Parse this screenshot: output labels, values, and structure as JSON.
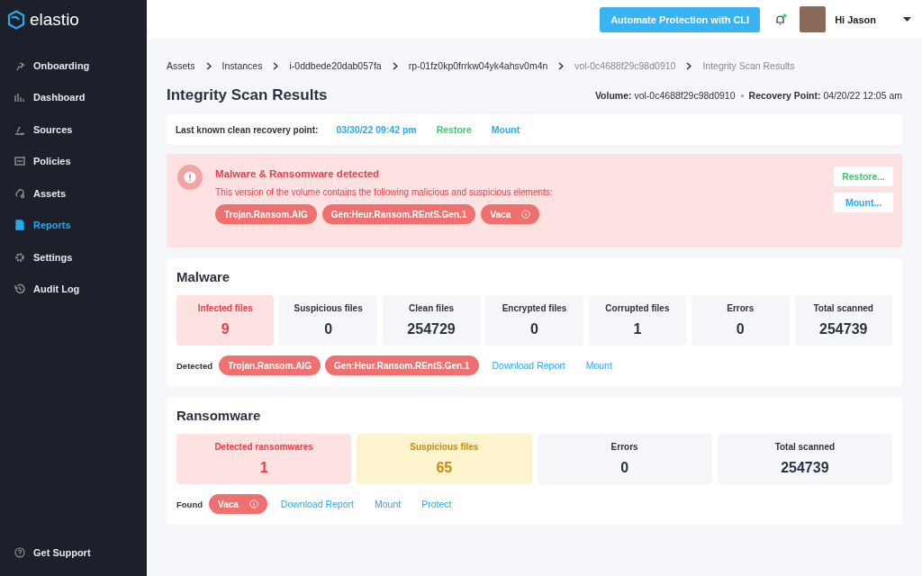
{
  "logo": {
    "text": "elastio"
  },
  "sidebar": {
    "items": [
      {
        "label": "Onboarding",
        "selected": false
      },
      {
        "label": "Dashboard",
        "selected": false
      },
      {
        "label": "Sources",
        "selected": false
      },
      {
        "label": "Policies",
        "selected": false
      },
      {
        "label": "Assets",
        "selected": false
      },
      {
        "label": "Reports",
        "selected": true
      },
      {
        "label": "Settings",
        "selected": false
      },
      {
        "label": "Audit Log",
        "selected": false
      }
    ],
    "support": "Get Support"
  },
  "topbar": {
    "cli_button": "Automate Protection with CLI",
    "notification_dot": true,
    "greeting": "Hi Jason"
  },
  "breadcrumbs": [
    {
      "label": "Assets",
      "current": false
    },
    {
      "label": "Instances",
      "current": false
    },
    {
      "label": "i-0ddbede20dab057fa",
      "current": false
    },
    {
      "label": "rp-01fz0kp0frrkw04yk4ahsv0m4n",
      "current": false
    },
    {
      "label": "vol-0c4688f29c98d0910",
      "current": true
    },
    {
      "label": "Integrity Scan Results",
      "current": true
    }
  ],
  "title": "Integrity Scan Results",
  "meta": [
    {
      "label": "Volume:",
      "value": "vol-0c4688f29c98d0910"
    },
    {
      "label": "Recovery Point:",
      "value": "04/20/22 12:05 am"
    }
  ],
  "clean_point": {
    "label": "Last known clean recovery point:",
    "date": "03/30/22 09:42 pm",
    "links": [
      {
        "label": "Restore",
        "kind": "restore"
      },
      {
        "label": "Mount",
        "kind": "mount"
      }
    ]
  },
  "alert": {
    "title": "Malware & Ransomware detected",
    "message": "This version of the volume contains the following malicious and suspicious elements:",
    "tags": [
      {
        "label": "Trojan.Ransom.AIG",
        "info": false
      },
      {
        "label": "Gen:Heur.Ransom.REntS.Gen.1",
        "info": false
      },
      {
        "label": "Vaca",
        "info": true
      }
    ],
    "buttons": [
      {
        "label": "Restore...",
        "kind": "restore"
      },
      {
        "label": "Mount...",
        "kind": "mount"
      }
    ]
  },
  "sections": [
    {
      "title": "Malware",
      "stats": [
        {
          "label": "Infected files",
          "value": "9",
          "kind": "danger"
        },
        {
          "label": "Suspicious files",
          "value": "0",
          "kind": "neutral"
        },
        {
          "label": "Clean files",
          "value": "254729",
          "kind": "neutral"
        },
        {
          "label": "Encrypted files",
          "value": "0",
          "kind": "neutral"
        },
        {
          "label": "Corrupted files",
          "value": "1",
          "kind": "neutral"
        },
        {
          "label": "Errors",
          "value": "0",
          "kind": "neutral"
        },
        {
          "label": "Total scanned",
          "value": "254739",
          "kind": "neutral"
        }
      ],
      "footer_label": "Detected",
      "tags": [
        {
          "label": "Trojan.Ransom.AIG",
          "info": false
        },
        {
          "label": "Gen:Heur.Ransom.REntS.Gen.1",
          "info": false
        }
      ],
      "links": [
        "Download Report",
        "Mount"
      ]
    },
    {
      "title": "Ransomware",
      "stats": [
        {
          "label": "Detected ransomwares",
          "value": "1",
          "kind": "danger"
        },
        {
          "label": "Suspicious files",
          "value": "65",
          "kind": "warning"
        },
        {
          "label": "Errors",
          "value": "0",
          "kind": "neutral"
        },
        {
          "label": "Total scanned",
          "value": "254739",
          "kind": "neutral"
        }
      ],
      "footer_label": "Found",
      "tags": [
        {
          "label": "Vaca",
          "info": true
        }
      ],
      "links": [
        "Download Report",
        "Mount",
        "Protect"
      ]
    }
  ]
}
